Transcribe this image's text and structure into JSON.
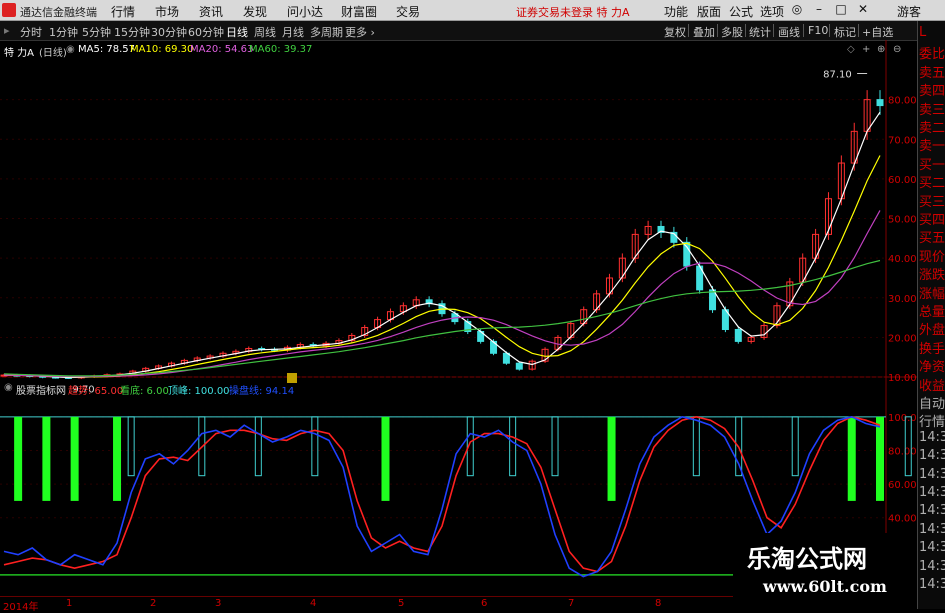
{
  "menubar": {
    "title": "通达信金融终端",
    "menu": [
      "行情",
      "市场",
      "资讯",
      "发现",
      "问小达",
      "财富圈",
      "交易"
    ],
    "status": "证券交易未登录",
    "stock_name": "特 力A",
    "right_menu": [
      "功能",
      "版面",
      "公式",
      "选项"
    ],
    "user": "游客"
  },
  "periodbar": {
    "periods": [
      "分时",
      "1分钟",
      "5分钟",
      "15分钟",
      "30分钟",
      "60分钟",
      "日线",
      "周线",
      "月线",
      "多周期",
      "更多"
    ],
    "active": "日线",
    "tools": [
      "复权",
      "叠加",
      "多股",
      "统计",
      "画线",
      "F10",
      "标记",
      "+自选"
    ]
  },
  "legend": {
    "stock": "特 力A",
    "period": "(日线)",
    "ma5": "MA5: 78.57",
    "ma10": "MA10: 69.30",
    "ma20": "MA20: 54.63",
    "ma60": "MA60: 39.37"
  },
  "price_axis": [
    "80.00",
    "70.00",
    "60.00",
    "50.00",
    "40.00",
    "30.00",
    "20.00",
    "10.00"
  ],
  "price_marks": {
    "high": "87.10",
    "low": "9.70"
  },
  "indicator_legend": {
    "name": "股票指标网",
    "trend": "趋势: 65.00",
    "bottom": "看底: 6.00",
    "top": "顶峰: 100.00",
    "line": "操盘线: 94.14"
  },
  "indicator_axis": [
    "100.00",
    "80.00",
    "60.00",
    "40.00"
  ],
  "side_panel": [
    "L",
    "委比",
    "卖五",
    "卖四",
    "卖三",
    "卖二",
    "卖一",
    "买一",
    "买二",
    "买三",
    "买四",
    "买五",
    "现价",
    "涨跌",
    "涨幅",
    "总量",
    "外盘",
    "换手",
    "净资",
    "收益",
    "自动",
    "行情",
    "14:3",
    "14:3",
    "14:3",
    "14:3",
    "14:3",
    "14:3",
    "14:3",
    "14:3",
    "14:3"
  ],
  "x_axis": [
    "2014年",
    "1",
    "2",
    "3",
    "4",
    "5",
    "6",
    "7",
    "8"
  ],
  "watermark": {
    "cn": "乐淘公式网",
    "url": "www.60lt.com"
  },
  "colors": {
    "up": "#ff3030",
    "down": "#40e0e0",
    "ma5": "#ffffff",
    "ma10": "#ffff00",
    "ma20": "#c040c0",
    "ma60": "#40c040",
    "ind_red": "#ff2020",
    "ind_blue": "#2040ff",
    "ind_green_bar": "#20ff20"
  },
  "chart_data": {
    "type": "line",
    "title": "",
    "price_ylim": [
      8,
      90
    ],
    "close": [
      10.5,
      10.4,
      10.2,
      10.0,
      9.9,
      9.8,
      10.1,
      10.3,
      10.6,
      10.8,
      11.5,
      12.2,
      12.8,
      13.5,
      14.2,
      14.8,
      15.3,
      16.0,
      16.5,
      17.2,
      17.0,
      16.8,
      17.5,
      18.2,
      17.9,
      18.5,
      19.2,
      20.5,
      22.5,
      24.5,
      26.5,
      28.0,
      29.5,
      28.5,
      26.0,
      24.0,
      21.5,
      19.0,
      16.0,
      13.5,
      12.0,
      14.0,
      17.0,
      20.0,
      23.5,
      27.0,
      31.0,
      35.0,
      40.0,
      46.0,
      48.0,
      46.5,
      44.0,
      38.0,
      32.0,
      27.0,
      22.0,
      19.0,
      20.0,
      23.0,
      28.0,
      34.0,
      40.0,
      46.0,
      55.0,
      64.0,
      72.0,
      80.0,
      78.5
    ],
    "ma60": [
      10.8,
      10.7,
      10.6,
      10.5,
      10.4,
      10.3,
      10.3,
      10.3,
      10.4,
      10.5,
      10.7,
      10.9,
      11.1,
      11.4,
      11.7,
      12.0,
      12.4,
      12.8,
      13.2,
      13.6,
      14.0,
      14.4,
      14.8,
      15.2,
      15.6,
      16.0,
      16.4,
      16.9,
      17.4,
      18.0,
      18.6,
      19.2,
      19.9,
      20.5,
      21.0,
      21.5,
      21.9,
      22.2,
      22.4,
      22.5,
      22.6,
      22.8,
      23.1,
      23.5,
      24.0,
      24.6,
      25.3,
      26.1,
      27.0,
      28.0,
      29.0,
      29.8,
      30.5,
      31.0,
      31.3,
      31.5,
      31.6,
      31.7,
      31.9,
      32.2,
      32.6,
      33.1,
      33.8,
      34.6,
      35.5,
      36.5,
      37.6,
      38.6,
      39.4
    ],
    "indicator_ylim": [
      0,
      110
    ],
    "operation_line": [
      20,
      18,
      22,
      15,
      12,
      18,
      15,
      12,
      25,
      55,
      75,
      78,
      72,
      80,
      90,
      92,
      88,
      95,
      90,
      85,
      88,
      92,
      90,
      86,
      70,
      35,
      20,
      25,
      30,
      20,
      18,
      45,
      78,
      90,
      88,
      92,
      85,
      80,
      60,
      30,
      10,
      5,
      8,
      20,
      45,
      72,
      88,
      95,
      100,
      98,
      95,
      88,
      72,
      50,
      30,
      38,
      55,
      78,
      92,
      98,
      100,
      96,
      94
    ],
    "trend_line": [
      12,
      14,
      16,
      15,
      12,
      10,
      12,
      14,
      18,
      40,
      65,
      75,
      76,
      74,
      82,
      90,
      92,
      92,
      90,
      87,
      86,
      90,
      92,
      90,
      80,
      50,
      28,
      22,
      26,
      22,
      20,
      35,
      65,
      85,
      90,
      90,
      88,
      84,
      70,
      45,
      20,
      10,
      8,
      14,
      35,
      62,
      82,
      92,
      98,
      100,
      98,
      93,
      82,
      62,
      40,
      34,
      48,
      68,
      86,
      96,
      100,
      98,
      95
    ],
    "bottom_signals": [
      1,
      3,
      5,
      8,
      27,
      43,
      60,
      62,
      67
    ],
    "top_signals": [
      9,
      14,
      18,
      22,
      33,
      36,
      39,
      49,
      52,
      56,
      64,
      66,
      70
    ]
  }
}
